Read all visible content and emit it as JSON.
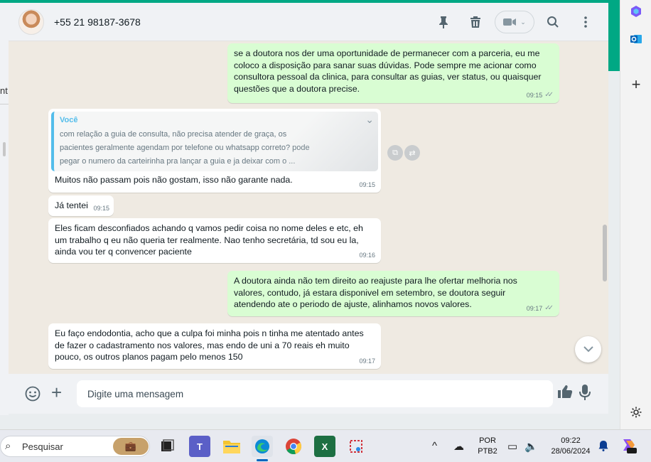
{
  "header": {
    "contact_name": "+55 21 98187-3678",
    "icons": [
      "pin-icon",
      "delete-icon",
      "video-call-icon",
      "search-icon",
      "menu-icon"
    ]
  },
  "background_window": {
    "fragment": "nt"
  },
  "messages": [
    {
      "direction": "out",
      "lines": [
        "se a doutora nos der uma oportunidade de permanecer com a parceria, eu me",
        "coloco a disposição para sanar suas dúvidas. Pode sempre me acionar como",
        "consultora pessoal da clinica, para consultar as guias, ver status, ou quaisquer",
        "questões que a doutora precise."
      ],
      "time": "09:15",
      "read": true
    },
    {
      "direction": "in",
      "quote": {
        "author": "Você",
        "lines": [
          "com relação a guia de consulta, não precisa atender de graça, os",
          "pacientes geralmente agendam por telefone ou whatsapp correto? pode",
          "pegar o numero da carteirinha pra lançar a guia e ja deixar com o ..."
        ]
      },
      "lines": [
        "Muitos não passam pois não gostam, isso não garante nada."
      ],
      "time": "09:15"
    },
    {
      "direction": "in",
      "lines": [
        "Já tentei"
      ],
      "time": "09:15"
    },
    {
      "direction": "in",
      "lines": [
        "Eles ficam desconfiados achando q vamos pedir coisa no nome deles e etc, eh",
        "um trabalho q eu não queria ter realmente. Nao tenho secretária, td sou eu la,",
        "ainda vou ter q convencer paciente"
      ],
      "time": "09:16"
    },
    {
      "direction": "out",
      "lines": [
        "A doutora ainda não tem direito ao reajuste para lhe ofertar melhoria nos",
        "valores, contudo, já estara disponivel em setembro, se doutora seguir",
        "atendendo ate o periodo de ajuste, alinhamos novos valores."
      ],
      "time": "09:17",
      "read": true
    },
    {
      "direction": "in",
      "lines": [
        "Eu faço endodontia, acho que a culpa foi minha pois n tinha me atentado antes",
        "de fazer o cadastramento nos valores, mas endo de uni a 70 reais eh muito",
        "pouco, os outros planos pagam pelo menos 150"
      ],
      "time": "09:17"
    }
  ],
  "composer": {
    "placeholder": "Digite uma mensagem"
  },
  "taskbar": {
    "search_text": "Pesquisar",
    "lang_top": "POR",
    "lang_bottom": "PTB2",
    "clock_time": "09:22",
    "clock_date": "28/06/2024",
    "apps": [
      "task-view",
      "teams",
      "file-explorer",
      "edge",
      "chrome",
      "excel",
      "snipping-tool"
    ]
  },
  "colors": {
    "accent": "#00a884",
    "outgoing_bubble": "#d9fdd3",
    "incoming_bubble": "#ffffff",
    "quote_author": "#53bdeb",
    "chat_bg": "#efeae2"
  }
}
